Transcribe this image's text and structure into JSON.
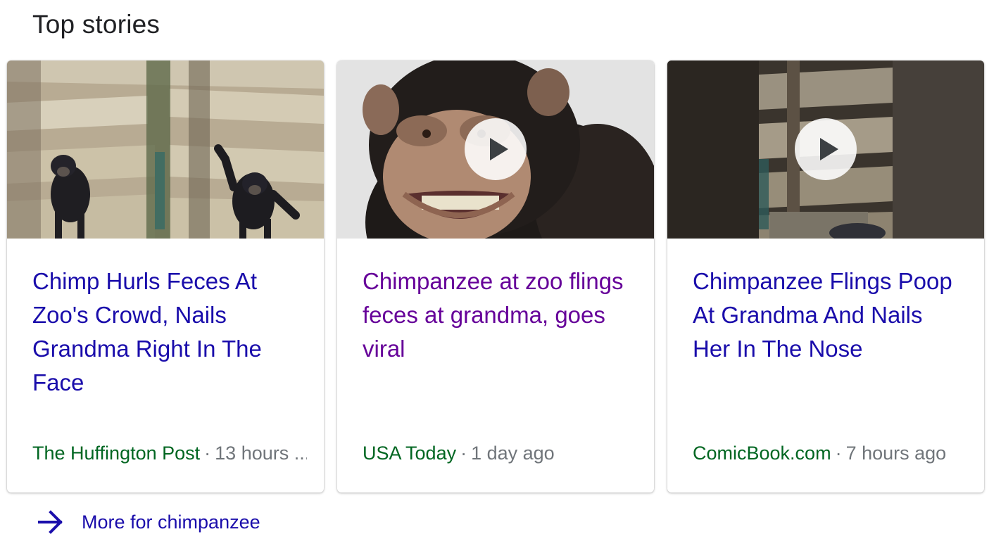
{
  "section": {
    "title": "Top stories"
  },
  "stories": [
    {
      "headline": "Chimp Hurls Feces At Zoo's Crowd, Nails Grandma Right In The Face",
      "source": "The Huffington Post",
      "time": "13 hours ...",
      "has_video": false,
      "visited": false
    },
    {
      "headline": "Chimpanzee at zoo flings feces at grandma, goes viral",
      "source": "USA Today",
      "time": "1 day ago",
      "has_video": true,
      "visited": true
    },
    {
      "headline": "Chimpanzee Flings Poop At Grandma And Nails Her In The Nose",
      "source": "ComicBook.com",
      "time": "7 hours ago",
      "has_video": true,
      "visited": false
    }
  ],
  "more": {
    "label": "More for chimpanzee",
    "icon": "arrow-right-icon"
  },
  "separator": "·",
  "colors": {
    "link": "#1a0dab",
    "visited": "#660099",
    "source": "#006621",
    "meta": "#70757a",
    "title": "#202124"
  }
}
